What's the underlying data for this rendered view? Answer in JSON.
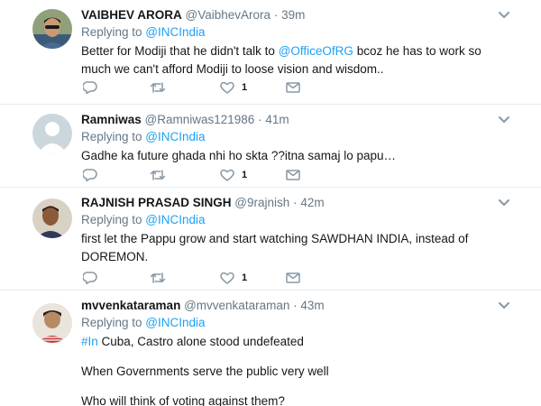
{
  "tweets": [
    {
      "name": "VAIBHEV ARORA",
      "handle": "@VaibhevArora",
      "time": "39m",
      "replying_prefix": "Replying to ",
      "replying_to": "@INCIndia",
      "text_parts": [
        "Better for Modiji that he didn't talk to ",
        "@OfficeOfRG",
        "  bcoz he has to work so much we can't afford Modiji to loose vision and wisdom.."
      ],
      "likes": "1"
    },
    {
      "name": "Ramniwas",
      "handle": "@Ramniwas121986",
      "time": "41m",
      "replying_prefix": "Replying to ",
      "replying_to": "@INCIndia",
      "text": "Gadhe ka future ghada nhi ho skta ??itna samaj lo papu…",
      "likes": "1"
    },
    {
      "name": "RAJNISH PRASAD SINGH",
      "handle": "@9rajnish",
      "time": "42m",
      "replying_prefix": "Replying to ",
      "replying_to": "@INCIndia",
      "text": "first let the Pappu grow and start watching SAWDHAN INDIA, instead of DOREMON.",
      "likes": "1"
    },
    {
      "name": "mvvenkataraman",
      "handle": "@mvvenkataraman",
      "time": "43m",
      "replying_prefix": "Replying to ",
      "replying_to": "@INCIndia",
      "hashtag": "#In",
      "line1_rest": " Cuba, Castro alone stood undefeated",
      "line2": "When Governments serve the public very well",
      "line3": "Who will think of voting against them?"
    }
  ],
  "separator": "·",
  "colors": {
    "link": "#1da1f2",
    "secondary": "#657786",
    "text": "#14171a",
    "divider": "#e6ecf0"
  },
  "icons": {
    "reply": "reply-icon",
    "retweet": "retweet-icon",
    "like": "heart-icon",
    "dm": "envelope-icon",
    "menu": "chevron-down-icon"
  }
}
